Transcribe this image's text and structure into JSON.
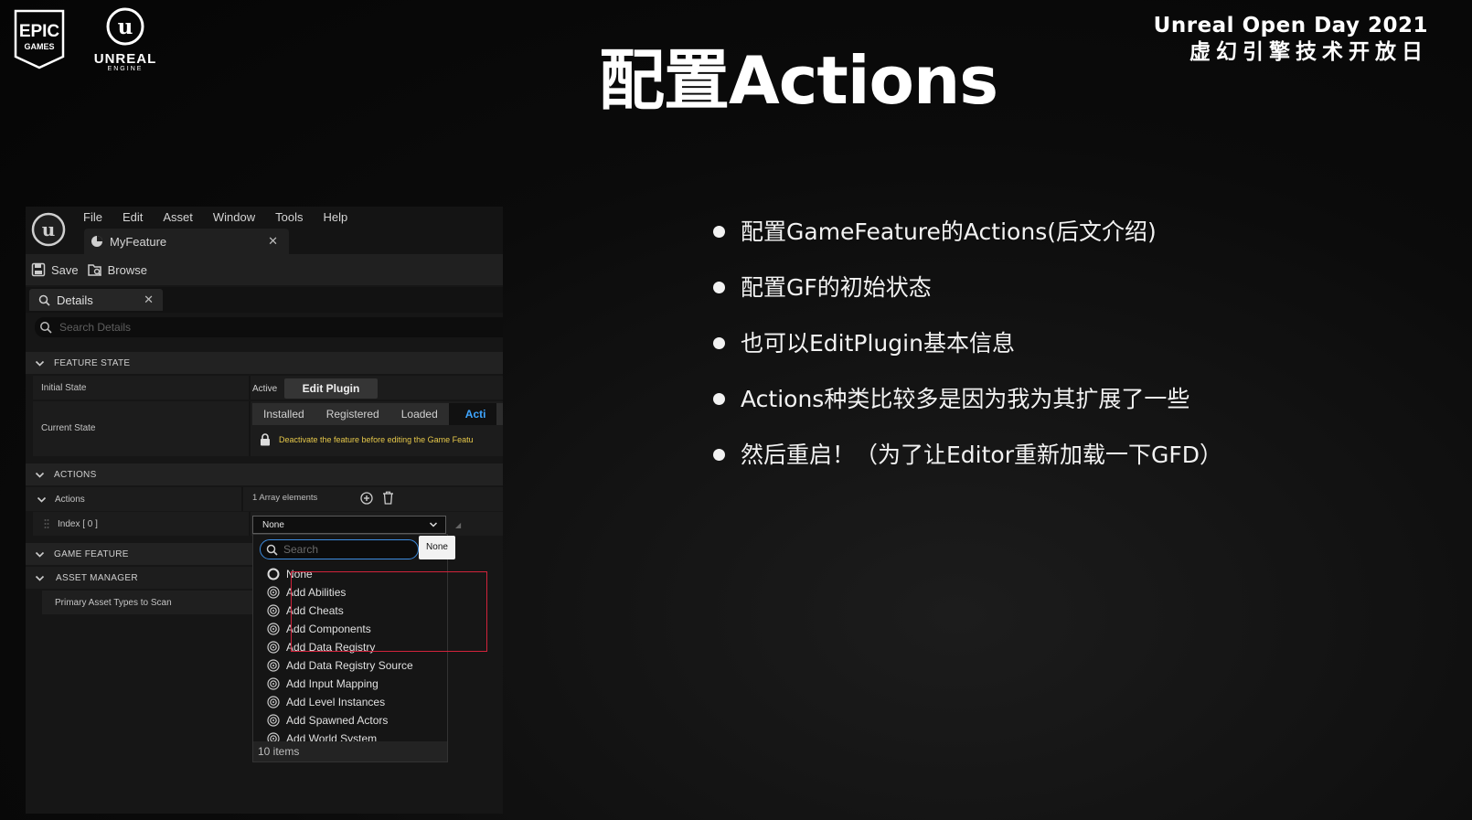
{
  "slide": {
    "title": "配置Actions",
    "event_en": "Unreal Open Day 2021",
    "event_zh": "虚幻引擎技术开放日",
    "epic_logo_text": [
      "EPIC",
      "GAMES"
    ],
    "unreal_logo_text": [
      "UNREAL",
      "ENGINE"
    ],
    "bullets": [
      "配置GameFeature的Actions(后文介绍)",
      "配置GF的初始状态",
      "也可以EditPlugin基本信息",
      "Actions种类比较多是因为我为其扩展了一些",
      "然后重启！（为了让Editor重新加载一下GFD）"
    ]
  },
  "editor": {
    "menu": [
      "File",
      "Edit",
      "Asset",
      "Window",
      "Tools",
      "Help"
    ],
    "document_tab": "MyFeature",
    "toolbar": {
      "save": "Save",
      "browse": "Browse"
    },
    "details_tab": "Details",
    "search_placeholder": "Search Details",
    "sections": {
      "feature_state": "FEATURE STATE",
      "actions": "ACTIONS",
      "game_feature": "GAME FEATURE",
      "asset_manager": "ASSET MANAGER"
    },
    "feature_state": {
      "initial_state_label": "Initial State",
      "initial_state_value": "Active",
      "edit_plugin": "Edit Plugin",
      "current_state_label": "Current State",
      "states": [
        "Installed",
        "Registered",
        "Loaded",
        "Acti"
      ],
      "active_state_index": 3,
      "warning": "Deactivate the feature before editing the Game Featu"
    },
    "actions": {
      "label": "Actions",
      "array_count": "1 Array elements",
      "index_label": "Index [ 0 ]",
      "combo_value": "None"
    },
    "asset_manager": {
      "primary_label": "Primary Asset Types to Scan"
    },
    "dropdown": {
      "search_placeholder": "Search",
      "tooltip": "None",
      "items": [
        "None",
        "Add Abilities",
        "Add Cheats",
        "Add Components",
        "Add Data Registry",
        "Add Data Registry Source",
        "Add Input Mapping",
        "Add Level Instances",
        "Add Spawned Actors",
        "Add World System"
      ],
      "footer": "10 items"
    }
  },
  "colors": {
    "highlight": "#d1233b",
    "active_state": "#3fa6ff",
    "warning": "#e6c84a",
    "search_focus": "#3d8ce0"
  }
}
